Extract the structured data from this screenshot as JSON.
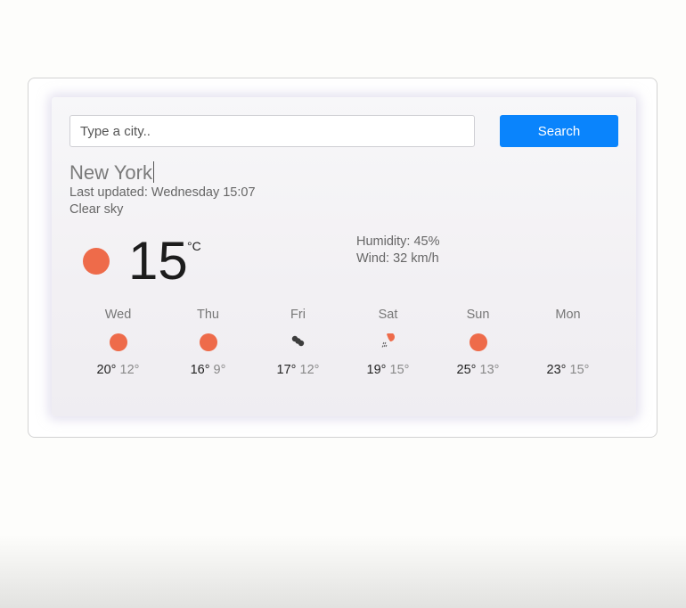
{
  "search": {
    "placeholder": "Type a city..",
    "value": "",
    "button_label": "Search"
  },
  "current": {
    "city": "New York",
    "last_updated": "Last updated: Wednesday 15:07",
    "description": "Clear sky",
    "temperature": "15",
    "unit": "°C",
    "icon": "sun-icon",
    "humidity": "Humidity: 45%",
    "wind": "Wind: 32 km/h"
  },
  "forecast": [
    {
      "day": "Wed",
      "max": "20°",
      "min": "12°",
      "icon": "sun-icon"
    },
    {
      "day": "Thu",
      "max": "16°",
      "min": "9°",
      "icon": "sun-icon"
    },
    {
      "day": "Fri",
      "max": "17°",
      "min": "12°",
      "icon": "cloud-icon"
    },
    {
      "day": "Sat",
      "max": "19°",
      "min": "15°",
      "icon": "rain-icon"
    },
    {
      "day": "Sun",
      "max": "25°",
      "min": "13°",
      "icon": "sun-icon"
    },
    {
      "day": "Mon",
      "max": "23°",
      "min": "15°",
      "icon": "none"
    }
  ],
  "colors": {
    "accent": "#0a84fc",
    "sun": "#ee6b4a",
    "cloud": "#3d3d3d"
  }
}
